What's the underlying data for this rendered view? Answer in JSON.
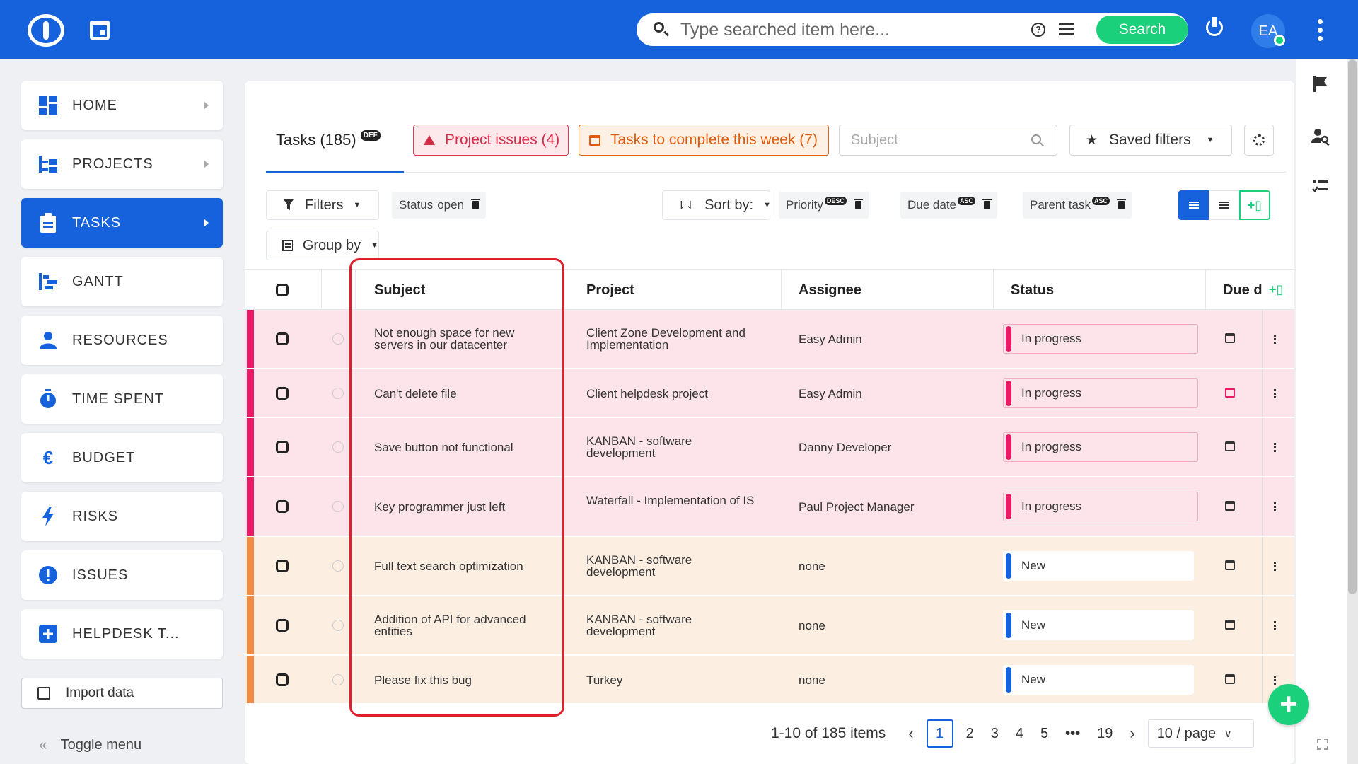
{
  "search": {
    "placeholder": "Type searched item here...",
    "button_label": "Search"
  },
  "user": {
    "initials": "EA"
  },
  "sidebar": {
    "items": [
      {
        "label": "HOME"
      },
      {
        "label": "PROJECTS"
      },
      {
        "label": "TASKS"
      },
      {
        "label": "GANTT"
      },
      {
        "label": "RESOURCES"
      },
      {
        "label": "TIME SPENT"
      },
      {
        "label": "BUDGET"
      },
      {
        "label": "RISKS"
      },
      {
        "label": "ISSUES"
      },
      {
        "label": "HELPDESK T..."
      }
    ],
    "import_label": "Import data",
    "toggle_label": "Toggle menu"
  },
  "tabs": {
    "tasks": {
      "label": "Tasks (185)",
      "badge": "DEF"
    },
    "issues": "Project issues (4)",
    "week": "Tasks to complete this week (7)"
  },
  "subject_filter": {
    "placeholder": "Subject"
  },
  "saved_filters": "Saved filters",
  "toolbar": {
    "filters": "Filters",
    "status_chip": {
      "label": "Status",
      "value": "open"
    },
    "sort_by": "Sort by:",
    "sorts": [
      {
        "label": "Priority",
        "dir": "DESC"
      },
      {
        "label": "Due date",
        "dir": "ASC"
      },
      {
        "label": "Parent task",
        "dir": "ASC"
      }
    ],
    "group_by": "Group by"
  },
  "table": {
    "columns": {
      "subject": "Subject",
      "project": "Project",
      "assignee": "Assignee",
      "status": "Status",
      "due": "Due d"
    },
    "rows": [
      {
        "subject": "Not enough space for new servers in our datacenter",
        "project": "Client Zone Development and Implementation",
        "assignee": "Easy Admin",
        "status": "In progress"
      },
      {
        "subject": "Can't delete file",
        "project": "Client helpdesk project",
        "assignee": "Easy Admin",
        "status": "In progress"
      },
      {
        "subject": "Save button not functional",
        "project": "KANBAN - software development",
        "assignee": "Danny Developer",
        "status": "In progress"
      },
      {
        "subject": "Key programmer just left",
        "project": "Waterfall - Implementation of IS",
        "assignee": "Paul Project Manager",
        "status": "In progress"
      },
      {
        "subject": "Full text search optimization",
        "project": "KANBAN - software development",
        "assignee": "none",
        "status": "New"
      },
      {
        "subject": "Addition of API for advanced entities",
        "project": "KANBAN - software development",
        "assignee": "none",
        "status": "New"
      },
      {
        "subject": "Please fix this bug",
        "project": "Turkey",
        "assignee": "none",
        "status": "New"
      }
    ]
  },
  "pagination": {
    "summary": "1-10 of 185 items",
    "pages": [
      "1",
      "2",
      "3",
      "4",
      "5",
      "•••",
      "19"
    ],
    "current": "1",
    "per_page": "10 / page"
  },
  "colors": {
    "brand": "#1662dd",
    "accent_green": "#1bd07b",
    "priority_high": "#ea1b66",
    "priority_normal": "#f08a45"
  }
}
